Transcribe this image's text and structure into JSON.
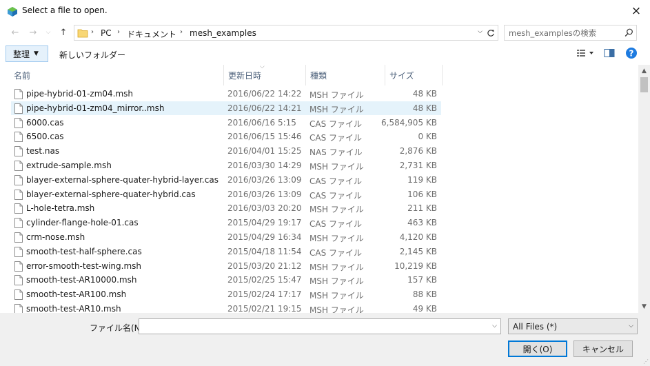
{
  "window": {
    "title": "Select a file to open.",
    "close_label": "×"
  },
  "nav": {
    "breadcrumbs": [
      "PC",
      "ドキュメント",
      "mesh_examples"
    ],
    "search_placeholder": "mesh_examplesの検索"
  },
  "toolbar": {
    "organize_label": "整理",
    "new_folder_label": "新しいフォルダー"
  },
  "columns": {
    "name": "名前",
    "date": "更新日時",
    "type": "種類",
    "size": "サイズ"
  },
  "files": [
    {
      "name": "pipe-hybrid-01-zm04.msh",
      "date": "2016/06/22 14:22",
      "type": "MSH ファイル",
      "size": "48 KB",
      "selected": false
    },
    {
      "name": "pipe-hybrid-01-zm04_mirror..msh",
      "date": "2016/06/22 14:21",
      "type": "MSH ファイル",
      "size": "48 KB",
      "selected": true
    },
    {
      "name": "6000.cas",
      "date": "2016/06/16 5:15",
      "type": "CAS ファイル",
      "size": "6,584,905 KB",
      "selected": false
    },
    {
      "name": "6500.cas",
      "date": "2016/06/15 15:46",
      "type": "CAS ファイル",
      "size": "0 KB",
      "selected": false
    },
    {
      "name": "test.nas",
      "date": "2016/04/01 15:25",
      "type": "NAS ファイル",
      "size": "2,876 KB",
      "selected": false
    },
    {
      "name": "extrude-sample.msh",
      "date": "2016/03/30 14:29",
      "type": "MSH ファイル",
      "size": "2,731 KB",
      "selected": false
    },
    {
      "name": "blayer-external-sphere-quater-hybrid-layer.cas",
      "date": "2016/03/26 13:09",
      "type": "CAS ファイル",
      "size": "119 KB",
      "selected": false
    },
    {
      "name": "blayer-external-sphere-quater-hybrid.cas",
      "date": "2016/03/26 13:09",
      "type": "CAS ファイル",
      "size": "106 KB",
      "selected": false
    },
    {
      "name": "L-hole-tetra.msh",
      "date": "2016/03/03 20:20",
      "type": "MSH ファイル",
      "size": "211 KB",
      "selected": false
    },
    {
      "name": "cylinder-flange-hole-01.cas",
      "date": "2015/04/29 19:17",
      "type": "CAS ファイル",
      "size": "463 KB",
      "selected": false
    },
    {
      "name": "crm-nose.msh",
      "date": "2015/04/29 16:34",
      "type": "MSH ファイル",
      "size": "4,120 KB",
      "selected": false
    },
    {
      "name": "smooth-test-half-sphere.cas",
      "date": "2015/04/18 11:54",
      "type": "CAS ファイル",
      "size": "2,145 KB",
      "selected": false
    },
    {
      "name": "error-smooth-test-wing.msh",
      "date": "2015/03/20 21:12",
      "type": "MSH ファイル",
      "size": "10,219 KB",
      "selected": false
    },
    {
      "name": "smooth-test-AR10000.msh",
      "date": "2015/02/25 15:47",
      "type": "MSH ファイル",
      "size": "157 KB",
      "selected": false
    },
    {
      "name": "smooth-test-AR100.msh",
      "date": "2015/02/24 17:17",
      "type": "MSH ファイル",
      "size": "88 KB",
      "selected": false
    },
    {
      "name": "smooth-test-AR10.msh",
      "date": "2015/02/21 19:15",
      "type": "MSH ファイル",
      "size": "49 KB",
      "selected": false
    }
  ],
  "footer": {
    "filename_label": "ファイル名(N):",
    "filename_value": "",
    "filter_value": "All Files (*)",
    "open_label": "開く(O)",
    "cancel_label": "キャンセル"
  },
  "colors": {
    "accent": "#0078d7",
    "selection": "#e5f3fb",
    "folder": "#f8d775",
    "help": "#1e7be0"
  },
  "icons": [
    "app-icon",
    "back-icon",
    "forward-icon",
    "recent-dropdown-icon",
    "up-icon",
    "folder-icon",
    "refresh-icon",
    "search-icon",
    "view-options-icon",
    "preview-pane-icon",
    "help-icon",
    "file-icon"
  ]
}
